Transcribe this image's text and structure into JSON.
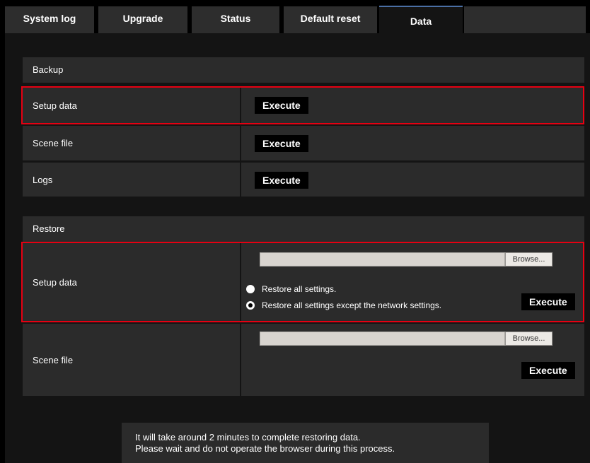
{
  "tabs": [
    {
      "label": "System log",
      "active": false
    },
    {
      "label": "Upgrade",
      "active": false
    },
    {
      "label": "Status",
      "active": false
    },
    {
      "label": "Default reset",
      "active": false
    },
    {
      "label": "Data",
      "active": true
    }
  ],
  "backup": {
    "title": "Backup",
    "rows": [
      {
        "label": "Setup data",
        "button": "Execute"
      },
      {
        "label": "Scene file",
        "button": "Execute"
      },
      {
        "label": "Logs",
        "button": "Execute"
      }
    ]
  },
  "restore": {
    "title": "Restore",
    "setup_data": {
      "label": "Setup data",
      "browse": "Browse...",
      "options": [
        {
          "label": "Restore all settings.",
          "checked": false
        },
        {
          "label": "Restore all settings except the network settings.",
          "checked": true
        }
      ],
      "button": "Execute"
    },
    "scene_file": {
      "label": "Scene file",
      "browse": "Browse...",
      "button": "Execute"
    }
  },
  "notice": {
    "line1": "It will take around 2 minutes to complete restoring data.",
    "line2": "Please wait and do not operate the browser during this process."
  },
  "colors": {
    "highlight": "#e60012",
    "active_tab_accent": "#4a6fa5"
  }
}
